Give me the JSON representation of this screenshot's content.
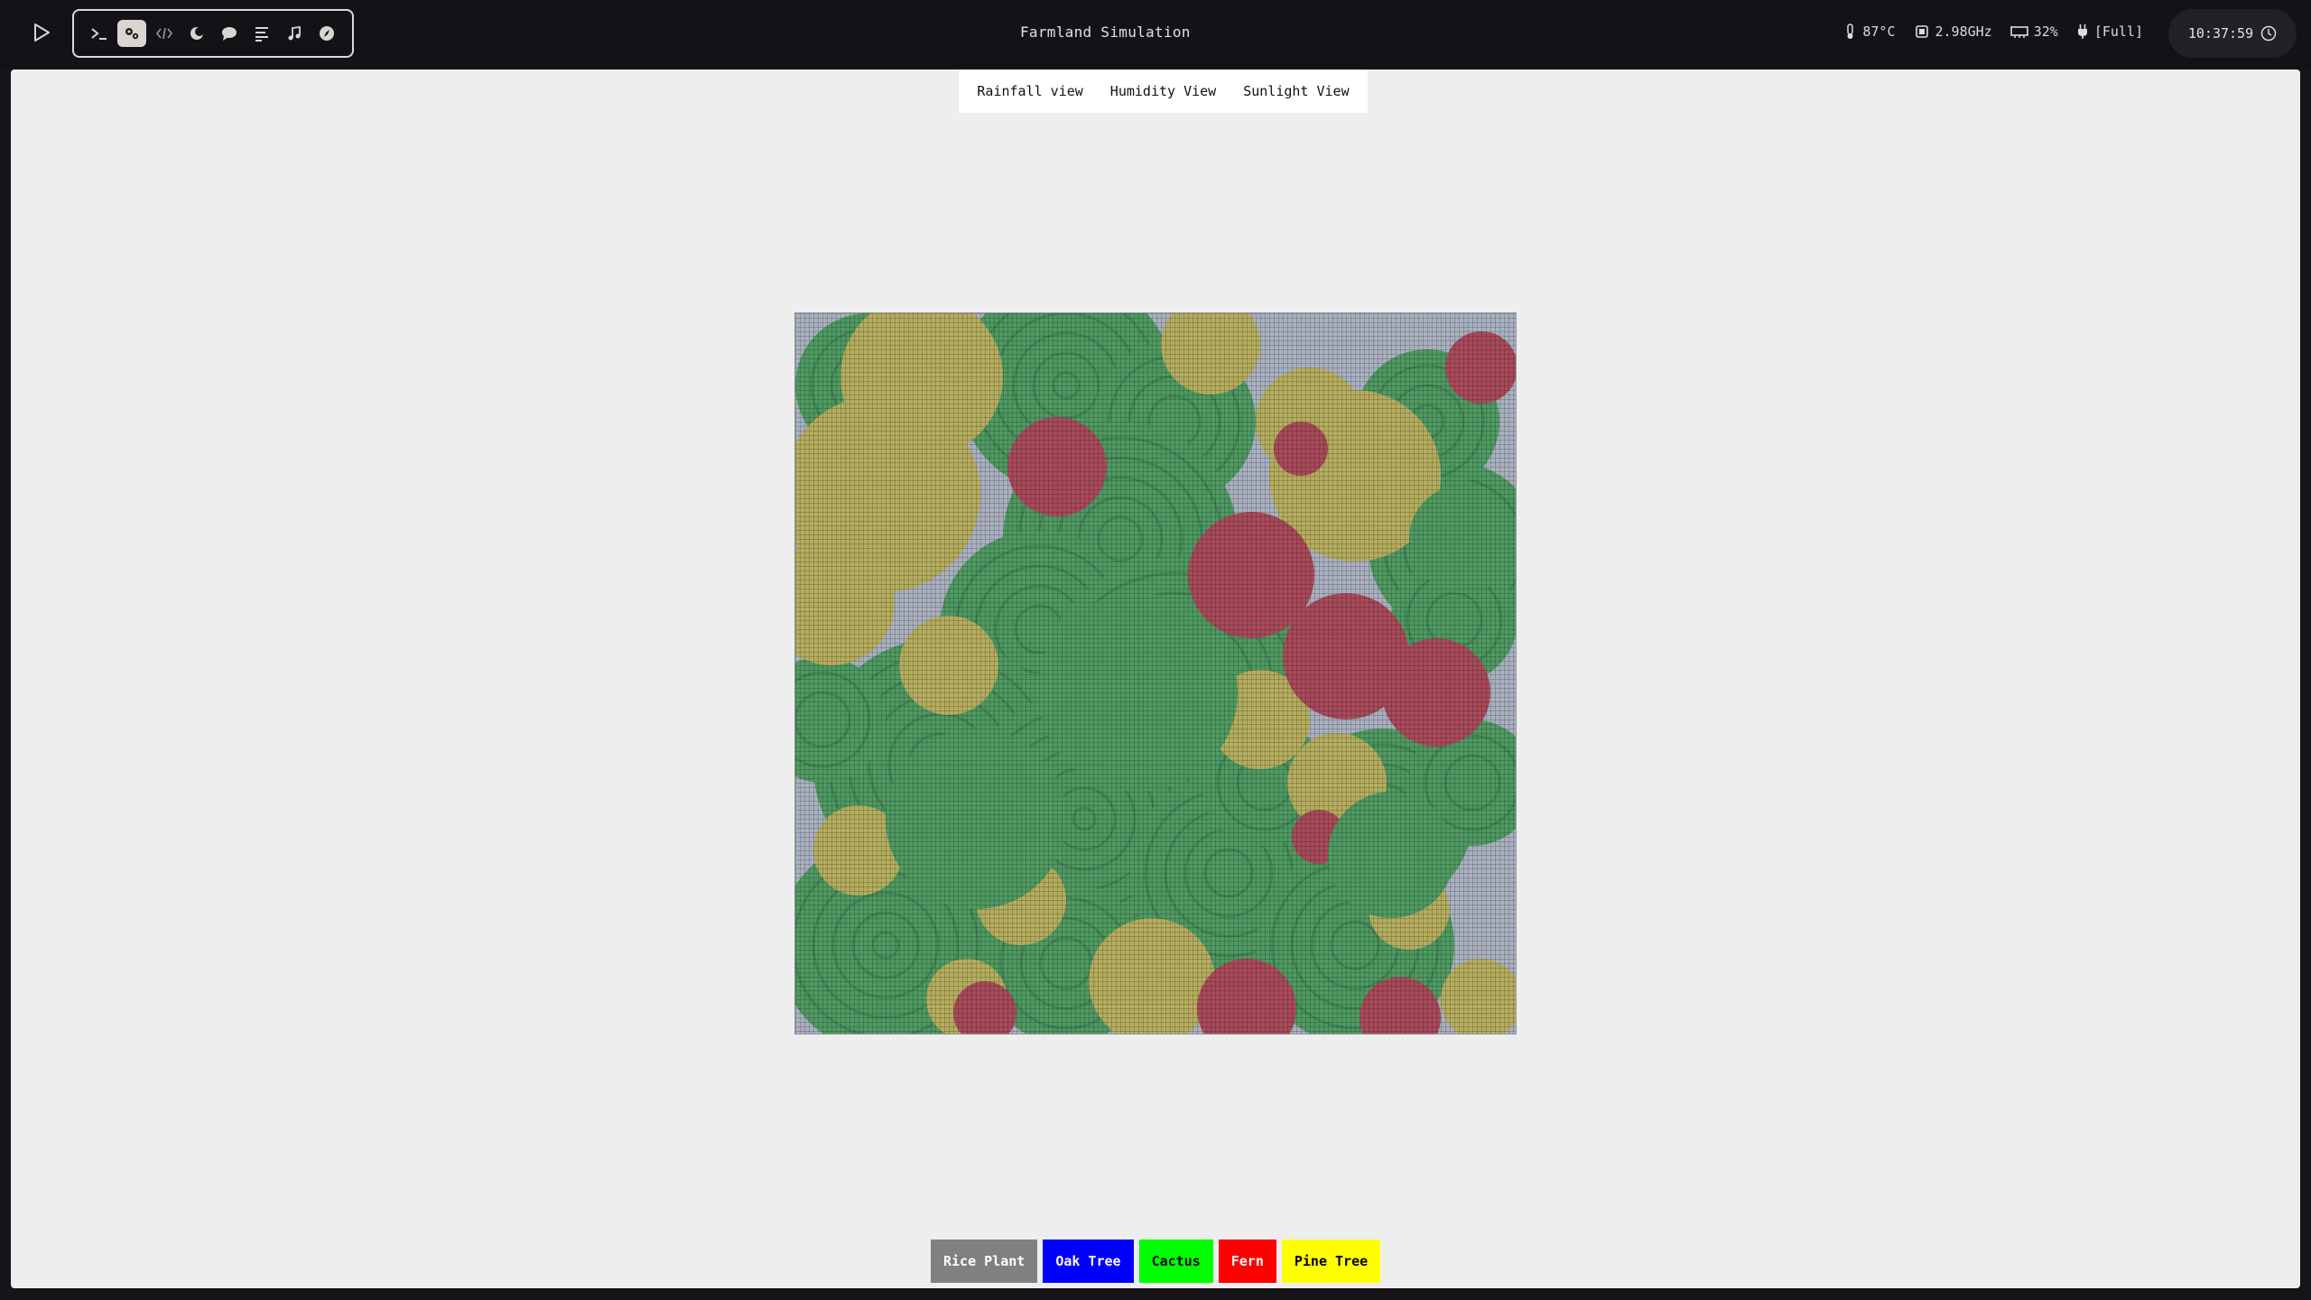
{
  "topbar": {
    "run_icon": "play-icon",
    "workspaces": [
      {
        "icon": "terminal-icon",
        "active": false
      },
      {
        "icon": "gears-icon",
        "active": true
      },
      {
        "icon": "code-icon",
        "active": false
      },
      {
        "icon": "moon-icon",
        "active": false
      },
      {
        "icon": "chat-icon",
        "active": false
      },
      {
        "icon": "list-icon",
        "active": false
      },
      {
        "icon": "music-icon",
        "active": false
      },
      {
        "icon": "compass-icon",
        "active": false
      }
    ],
    "title": "Farmland Simulation",
    "status": {
      "temperature": "87°C",
      "cpu_freq": "2.98GHz",
      "memory": "32%",
      "battery": "[Full]"
    },
    "clock": "10:37:59"
  },
  "views": {
    "rainfall": "Rainfall view",
    "humidity": "Humidity View",
    "sunlight": "Sunlight View"
  },
  "map": {
    "colors": {
      "ground": "#a9b0bf",
      "green": "#4f9a62",
      "green_dark": "#3f7f52",
      "yellow": "#b5ad5e",
      "red": "#a84a5a"
    }
  },
  "legend": [
    {
      "label": "Rice Plant",
      "bg": "#808080",
      "fg": "#ffffff"
    },
    {
      "label": "Oak Tree",
      "bg": "#0000ff",
      "fg": "#ffffff"
    },
    {
      "label": "Cactus",
      "bg": "#00ff00",
      "fg": "#000000"
    },
    {
      "label": "Fern",
      "bg": "#ff0000",
      "fg": "#ffffff"
    },
    {
      "label": "Pine Tree",
      "bg": "#ffff00",
      "fg": "#000000"
    }
  ]
}
